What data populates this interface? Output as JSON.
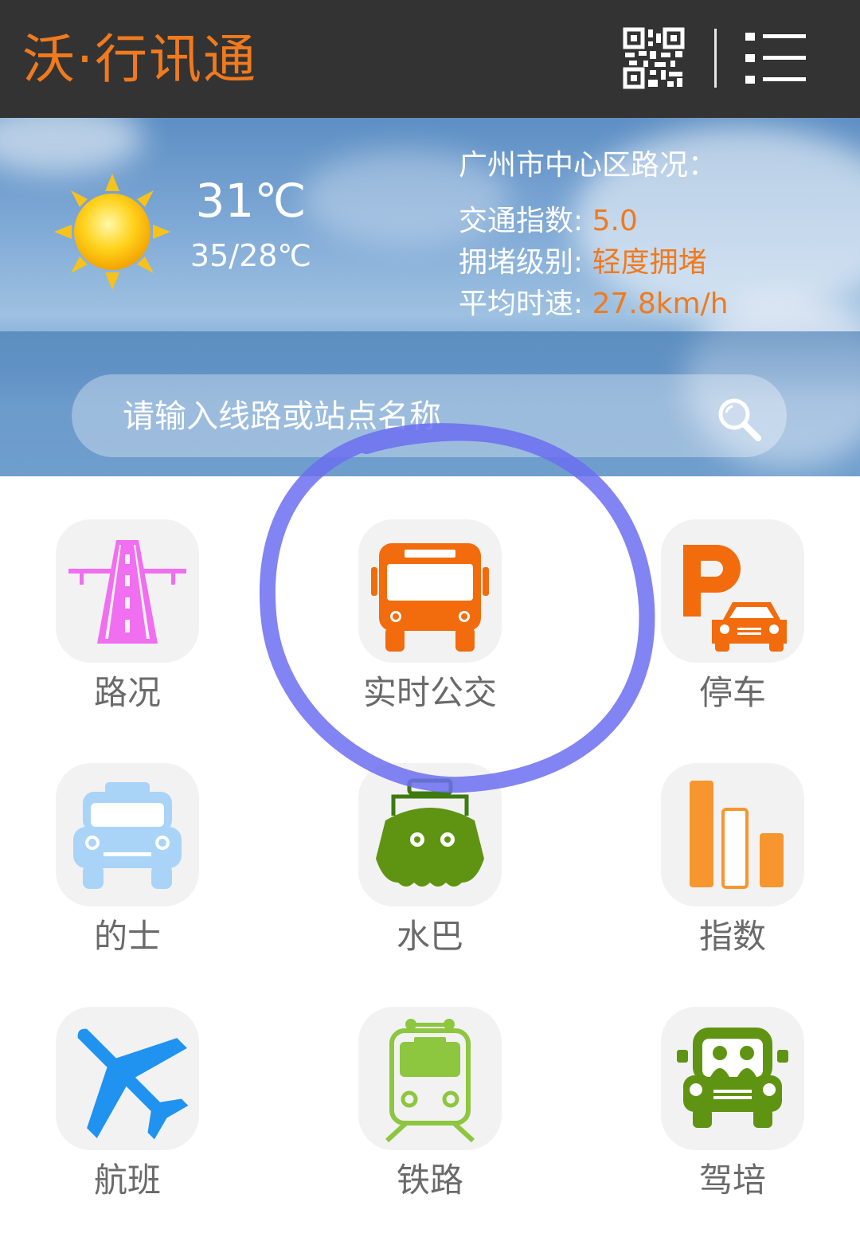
{
  "header": {
    "app_title": "沃·行讯通"
  },
  "weather": {
    "current_temp": "31℃",
    "temp_range": "35/28℃",
    "condition_icon": "sun-icon"
  },
  "traffic": {
    "title": "广州市中心区路况：",
    "index_label": "交通指数:",
    "index_value": "5.0",
    "level_label": "拥堵级别:",
    "level_value": "轻度拥堵",
    "speed_label": "平均时速:",
    "speed_value": "27.8km/h"
  },
  "search": {
    "placeholder": "请输入线路或站点名称"
  },
  "grid": {
    "items": [
      {
        "label": "路况",
        "icon": "road-icon"
      },
      {
        "label": "实时公交",
        "icon": "bus-icon"
      },
      {
        "label": "停车",
        "icon": "parking-icon"
      },
      {
        "label": "的士",
        "icon": "taxi-icon"
      },
      {
        "label": "水巴",
        "icon": "ferry-icon"
      },
      {
        "label": "指数",
        "icon": "bar-chart-icon"
      },
      {
        "label": "航班",
        "icon": "airplane-icon"
      },
      {
        "label": "铁路",
        "icon": "train-icon"
      },
      {
        "label": "驾培",
        "icon": "driving-school-icon"
      }
    ]
  },
  "colors": {
    "accent": "#f07a1e",
    "topbar": "#333333",
    "label": "#6a6a6a",
    "annotation": "#6b6ff0"
  }
}
